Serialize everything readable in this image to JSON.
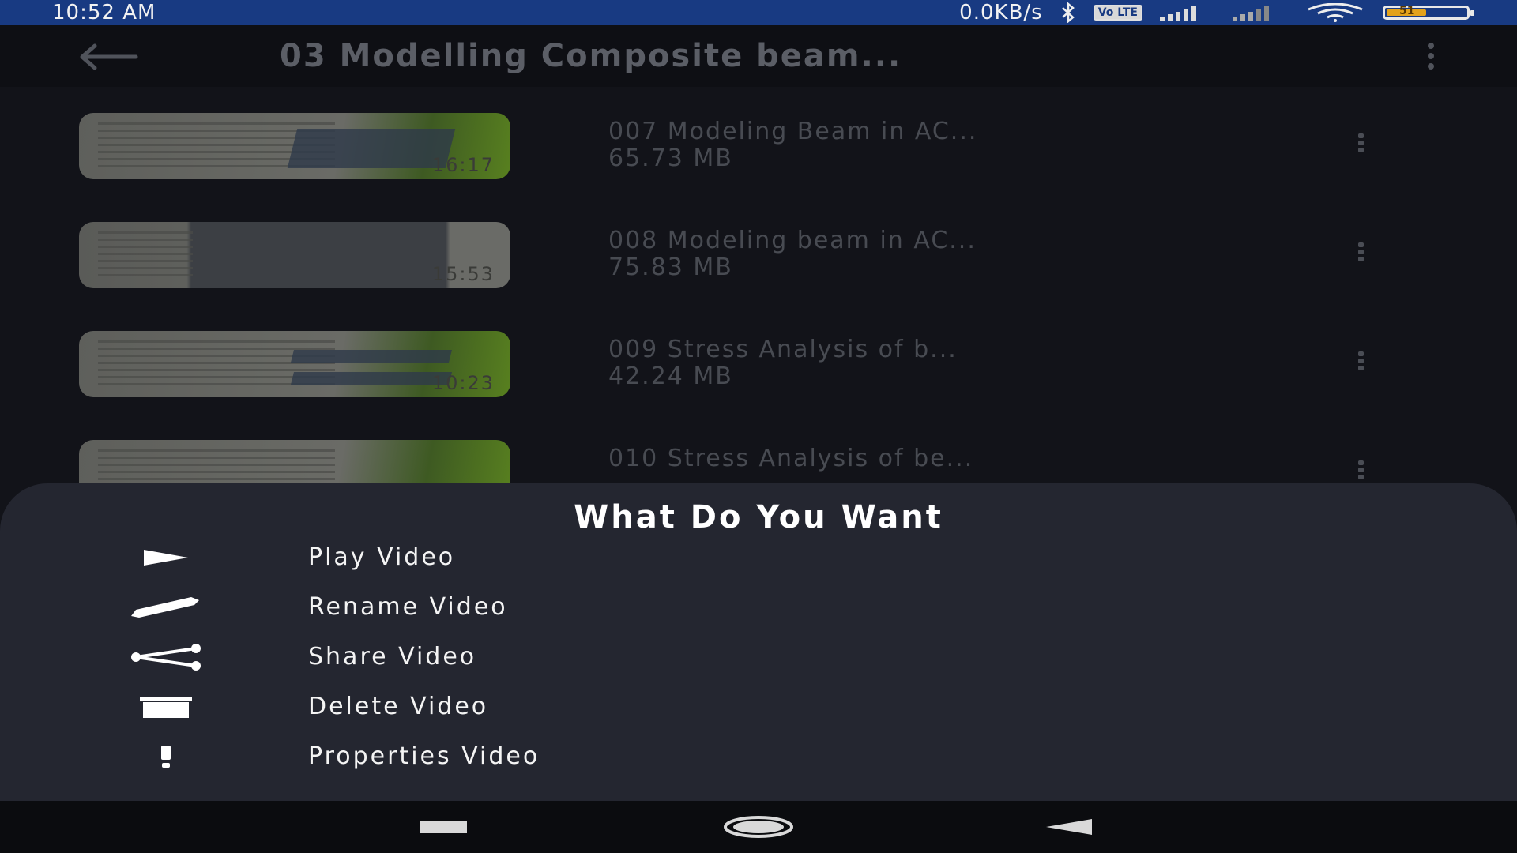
{
  "status_bar": {
    "time": "10:52 AM",
    "net_speed": "0.0KB/s",
    "vo_label": "Vo LTE",
    "battery_text": "51",
    "icons": [
      "bluetooth-icon",
      "volte-icon",
      "signal-icon",
      "signal-icon-2",
      "wifi-icon",
      "battery-icon"
    ]
  },
  "app_bar": {
    "title": "03 Modelling Composite beam...",
    "back_icon": "arrow-left-icon",
    "more_icon": "more-vertical-icon"
  },
  "videos": [
    {
      "name": "007 Modeling Beam in AC...",
      "size": "65.73 MB",
      "duration": "16:17"
    },
    {
      "name": "008 Modeling beam in AC...",
      "size": "75.83 MB",
      "duration": "15:53"
    },
    {
      "name": "009 Stress Analysis of b...",
      "size": "42.24 MB",
      "duration": "10:23"
    },
    {
      "name": "010 Stress Analysis of be...",
      "size": "",
      "duration": ""
    }
  ],
  "sheet": {
    "title": "What Do You Want",
    "options": [
      {
        "label": "Play Video",
        "icon": "play-icon"
      },
      {
        "label": "Rename Video",
        "icon": "pencil-icon"
      },
      {
        "label": "Share Video",
        "icon": "share-icon"
      },
      {
        "label": "Delete Video",
        "icon": "trash-icon"
      },
      {
        "label": "Properties Video",
        "icon": "exclamation-icon"
      }
    ]
  },
  "nav_bar": {
    "icons": [
      "recents-square-icon",
      "home-circle-icon",
      "back-triangle-icon"
    ]
  },
  "colors": {
    "status_bar": "#183a82",
    "app_bar": "#0e0f14",
    "background": "#121319",
    "sheet": "#242630",
    "nav_bar": "#0b0c0f"
  }
}
